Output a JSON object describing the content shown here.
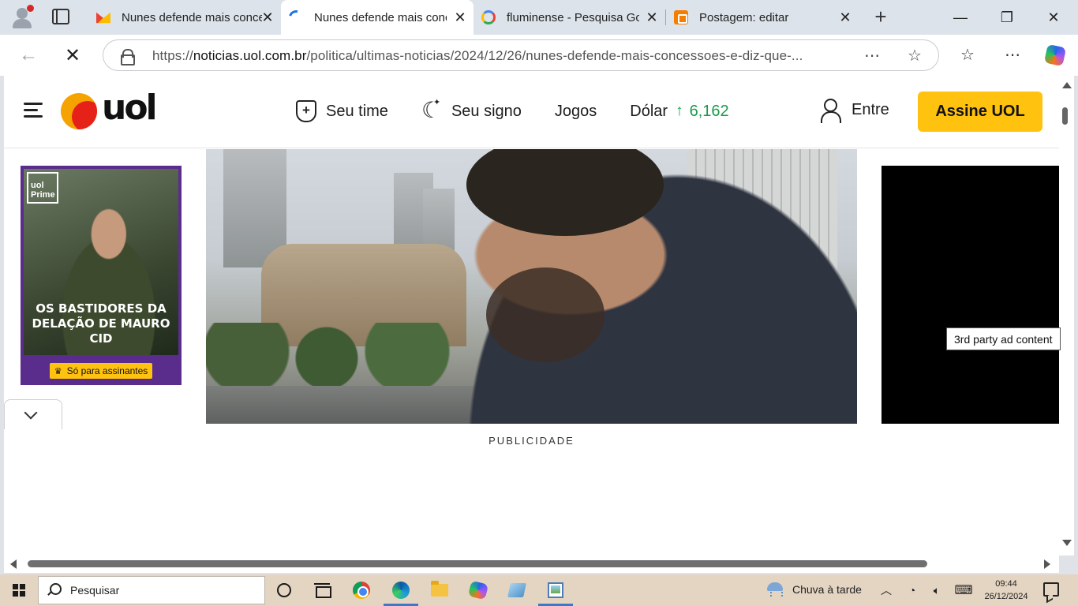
{
  "browser": {
    "tabs": [
      {
        "label": "Nunes defende mais concessões",
        "icon": "gmail-icon",
        "active": false
      },
      {
        "label": "Nunes defende mais concessões",
        "icon": "loading-spinner-icon",
        "active": true
      },
      {
        "label": "fluminense - Pesquisa Google",
        "icon": "google-icon",
        "active": false
      },
      {
        "label": "Postagem: editar",
        "icon": "blogger-icon",
        "active": false
      }
    ],
    "url_prefix": "https://",
    "url_host": "noticias.uol.com.br",
    "url_path": "/politica/ultimas-noticias/2024/12/26/nunes-defende-mais-concessoes-e-diz-que-..."
  },
  "site": {
    "logo_text": "uol",
    "nav": {
      "seu_time": "Seu time",
      "seu_signo": "Seu signo",
      "jogos": "Jogos",
      "dolar_label": "Dólar",
      "dolar_value": "6,162"
    },
    "login_label": "Entre",
    "subscribe_label": "Assine UOL"
  },
  "left_ad": {
    "badge_line1": "uol",
    "badge_line2": "Prime",
    "headline": "OS BASTIDORES DA DELAÇÃO DE MAURO CID",
    "cta": "Só para assinantes"
  },
  "right_ad": {
    "label": "3rd party ad content"
  },
  "ad_strip": {
    "label": "PUBLICIDADE"
  },
  "taskbar": {
    "search_placeholder": "Pesquisar",
    "weather": "Chuva à tarde",
    "time": "09:44",
    "date": "26/12/2024"
  },
  "colors": {
    "brand_yellow": "#ffc20e",
    "dolar_green": "#1a9a4a",
    "taskbar": "#e4d4c2"
  }
}
